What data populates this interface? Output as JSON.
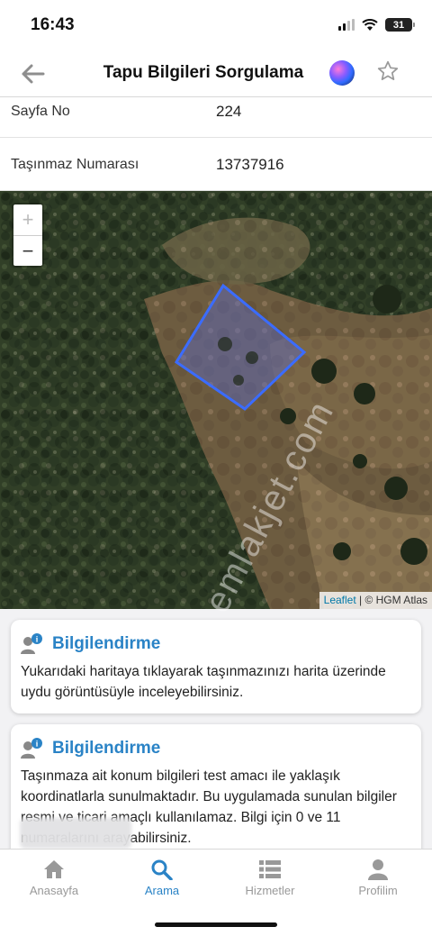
{
  "status_bar": {
    "time": "16:43",
    "battery": "31"
  },
  "nav": {
    "title": "Tapu Bilgileri Sorgulama"
  },
  "rows": [
    {
      "label": "Sayfa No",
      "value": "224"
    },
    {
      "label": "Taşınmaz Numarası",
      "value": "13737916"
    }
  ],
  "map": {
    "zoom_in": "+",
    "zoom_out": "−",
    "attribution_link": "Leaflet",
    "attribution_text": "| © HGM Atlas",
    "watermark": "emlakjet.com",
    "parcel_color": "#3b6cff"
  },
  "cards": [
    {
      "title": "Bilgilendirme",
      "body": "Yukarıdaki haritaya tıklayarak taşınmazınızı harita üzerinde uydu görüntüsüyle inceleyebilirsiniz."
    },
    {
      "title": "Bilgilendirme",
      "body": "Taşınmaza ait konum bilgileri test amacı ile yaklaşık koordinatlarla sunulmaktadır. Bu uygulamada sunulan bilgiler resmi ve ticari amaçlı kullanılamaz. Bilgi için 0 ve 11 numaralarını arayabilirsiniz."
    }
  ],
  "tabs": [
    {
      "label": "Anasayfa",
      "icon": "home-icon"
    },
    {
      "label": "Arama",
      "icon": "search-icon",
      "active": true
    },
    {
      "label": "Hizmetler",
      "icon": "list-icon"
    },
    {
      "label": "Profilim",
      "icon": "user-icon"
    }
  ],
  "colors": {
    "accent": "#2a83c6",
    "inactive": "#999999"
  }
}
